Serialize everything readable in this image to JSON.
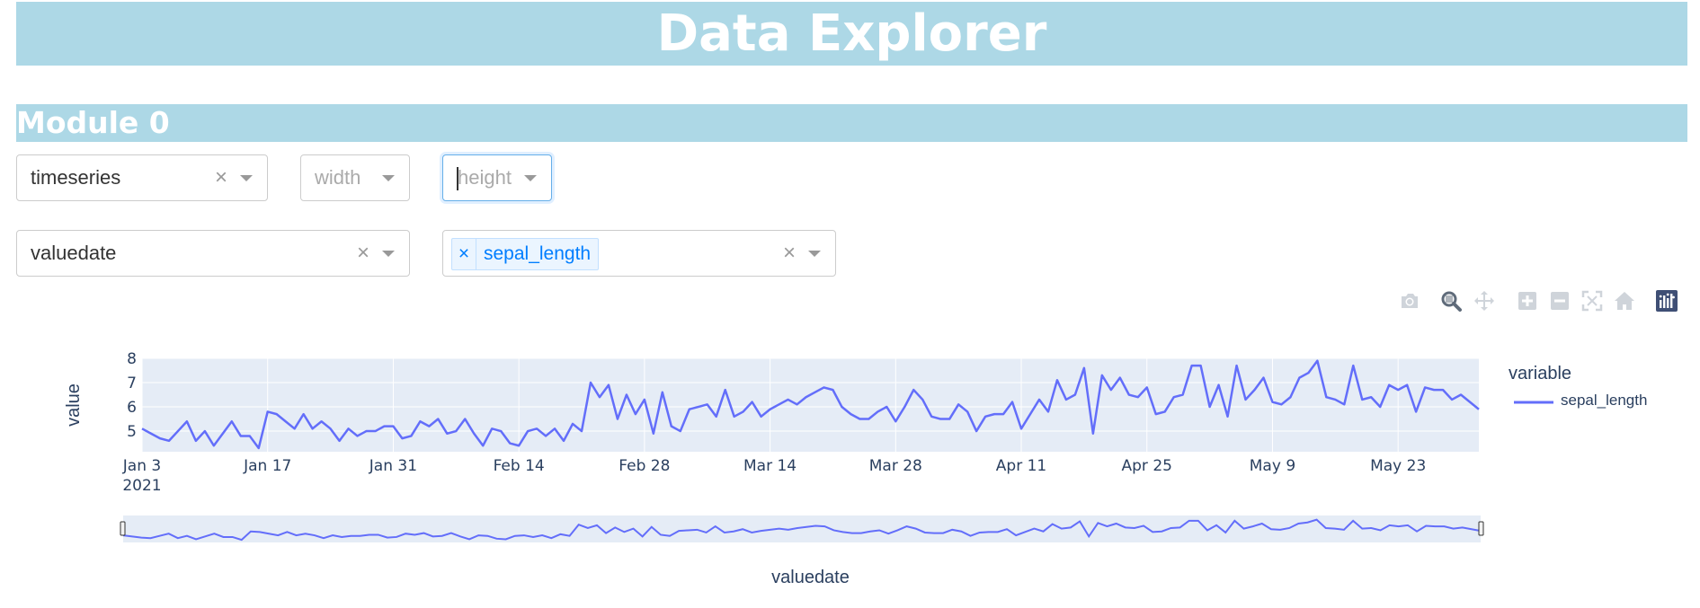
{
  "app": {
    "title": "Data Explorer"
  },
  "module": {
    "title": "Module 0",
    "controls": {
      "chart_type": {
        "value": "timeseries",
        "clear_icon": "×"
      },
      "width": {
        "placeholder": "width"
      },
      "height": {
        "placeholder": "height"
      },
      "x_column": {
        "value": "valuedate",
        "clear_icon": "×"
      },
      "y_columns": {
        "tags": [
          {
            "label": "sepal_length",
            "remove_icon": "×"
          }
        ],
        "clear_icon": "×"
      }
    }
  },
  "modebar": [
    {
      "name": "camera-icon",
      "title": "Download plot as a png"
    },
    {
      "name": "zoom-icon",
      "title": "Zoom",
      "active": true
    },
    {
      "name": "pan-icon",
      "title": "Pan"
    },
    {
      "name": "zoom-in-icon",
      "title": "Zoom in"
    },
    {
      "name": "zoom-out-icon",
      "title": "Zoom out"
    },
    {
      "name": "autoscale-icon",
      "title": "Autoscale"
    },
    {
      "name": "home-icon",
      "title": "Reset axes"
    },
    {
      "name": "plotly-logo-icon",
      "title": "Produced with Plotly"
    }
  ],
  "chart_data": {
    "type": "line",
    "xlabel": "valuedate",
    "ylabel": "value",
    "legend_title": "variable",
    "legend_position": "right",
    "grid": true,
    "rangeslider": true,
    "x_start": "2021-01-03",
    "x_end": "2021-06-01",
    "ylim": [
      4.15,
      8.0
    ],
    "x_ticks": [
      "Jan 3",
      "Jan 17",
      "Jan 31",
      "Feb 14",
      "Feb 28",
      "Mar 14",
      "Mar 28",
      "Apr 11",
      "Apr 25",
      "May 9",
      "May 23"
    ],
    "x_year_label": "2021",
    "y_ticks": [
      "5",
      "6",
      "7",
      "8"
    ],
    "colors": {
      "series": "#636efa",
      "plot_bg": "#e5ecf6",
      "grid": "#ffffff",
      "text": "#2a3f5f"
    },
    "series": [
      {
        "name": "sepal_length",
        "values": [
          5.1,
          4.9,
          4.7,
          4.6,
          5.0,
          5.4,
          4.6,
          5.0,
          4.4,
          4.9,
          5.4,
          4.8,
          4.8,
          4.3,
          5.8,
          5.7,
          5.4,
          5.1,
          5.7,
          5.1,
          5.4,
          5.1,
          4.6,
          5.1,
          4.8,
          5.0,
          5.0,
          5.2,
          5.2,
          4.7,
          4.8,
          5.4,
          5.2,
          5.5,
          4.9,
          5.0,
          5.5,
          4.9,
          4.4,
          5.1,
          5.0,
          4.5,
          4.4,
          5.0,
          5.1,
          4.8,
          5.1,
          4.6,
          5.3,
          5.0,
          7.0,
          6.4,
          6.9,
          5.5,
          6.5,
          5.7,
          6.3,
          4.9,
          6.6,
          5.2,
          5.0,
          5.9,
          6.0,
          6.1,
          5.6,
          6.7,
          5.6,
          5.8,
          6.2,
          5.6,
          5.9,
          6.1,
          6.3,
          6.1,
          6.4,
          6.6,
          6.8,
          6.7,
          6.0,
          5.7,
          5.5,
          5.5,
          5.8,
          6.0,
          5.4,
          6.0,
          6.7,
          6.3,
          5.6,
          5.5,
          5.5,
          6.1,
          5.8,
          5.0,
          5.6,
          5.7,
          5.7,
          6.2,
          5.1,
          5.7,
          6.3,
          5.8,
          7.1,
          6.3,
          6.5,
          7.6,
          4.9,
          7.3,
          6.7,
          7.2,
          6.5,
          6.4,
          6.8,
          5.7,
          5.8,
          6.4,
          6.5,
          7.7,
          7.7,
          6.0,
          6.9,
          5.6,
          7.7,
          6.3,
          6.7,
          7.2,
          6.2,
          6.1,
          6.4,
          7.2,
          7.4,
          7.9,
          6.4,
          6.3,
          6.1,
          7.7,
          6.3,
          6.4,
          6.0,
          6.9,
          6.7,
          6.9,
          5.8,
          6.8,
          6.7,
          6.7,
          6.3,
          6.5,
          6.2,
          5.9
        ]
      }
    ]
  }
}
